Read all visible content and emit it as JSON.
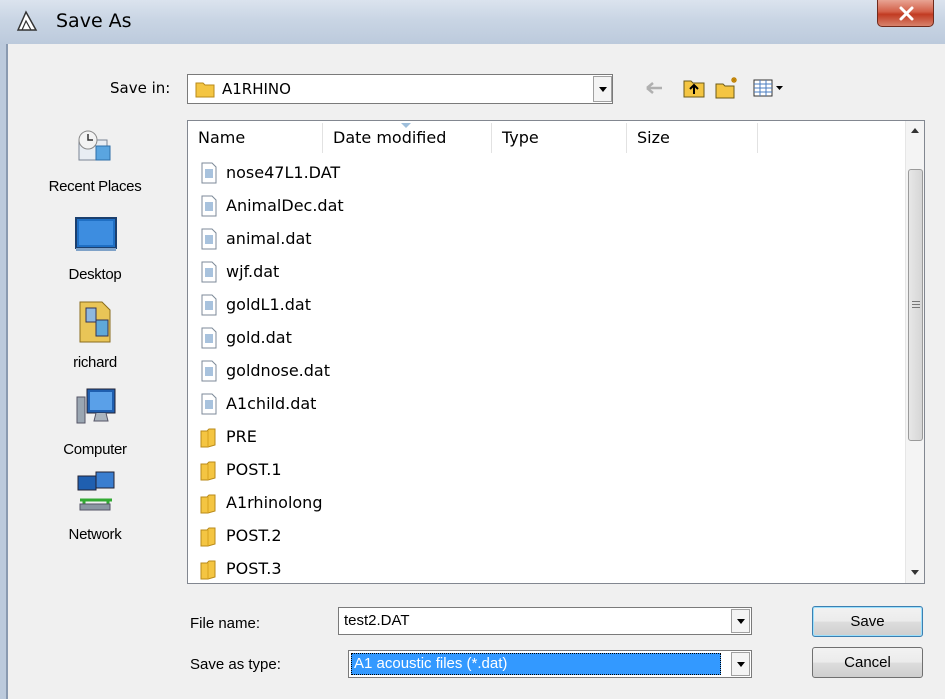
{
  "window": {
    "title": "Save As"
  },
  "lookin": {
    "label": "Save in:",
    "value": "A1RHINO"
  },
  "places": [
    {
      "label": "Recent Places"
    },
    {
      "label": "Desktop"
    },
    {
      "label": "richard"
    },
    {
      "label": "Computer"
    },
    {
      "label": "Network"
    }
  ],
  "columns": [
    "Name",
    "Date modified",
    "Type",
    "Size"
  ],
  "files": [
    {
      "name": "nose47L1.DAT",
      "kind": "file"
    },
    {
      "name": "AnimalDec.dat",
      "kind": "file"
    },
    {
      "name": "animal.dat",
      "kind": "file"
    },
    {
      "name": "wjf.dat",
      "kind": "file"
    },
    {
      "name": "goldL1.dat",
      "kind": "file"
    },
    {
      "name": "gold.dat",
      "kind": "file"
    },
    {
      "name": "goldnose.dat",
      "kind": "file"
    },
    {
      "name": "A1child.dat",
      "kind": "file"
    },
    {
      "name": "PRE",
      "kind": "folder"
    },
    {
      "name": "POST.1",
      "kind": "folder"
    },
    {
      "name": "A1rhinolong",
      "kind": "folder"
    },
    {
      "name": "POST.2",
      "kind": "folder"
    },
    {
      "name": "POST.3",
      "kind": "folder"
    }
  ],
  "filename": {
    "label": "File name:",
    "value": "test2.DAT"
  },
  "filetype": {
    "label": "Save as type:",
    "value": "A1 acoustic files (*.dat)"
  },
  "buttons": {
    "save": "Save",
    "cancel": "Cancel"
  },
  "icons": {
    "title": "save-as-icon",
    "close": "close-icon",
    "back": "back-arrow-icon",
    "up": "up-folder-icon",
    "newfolder": "new-folder-icon",
    "views": "views-menu-icon"
  },
  "colors": {
    "selection": "#3399ff",
    "close": "#c13b22",
    "folder": "#f4c542"
  }
}
